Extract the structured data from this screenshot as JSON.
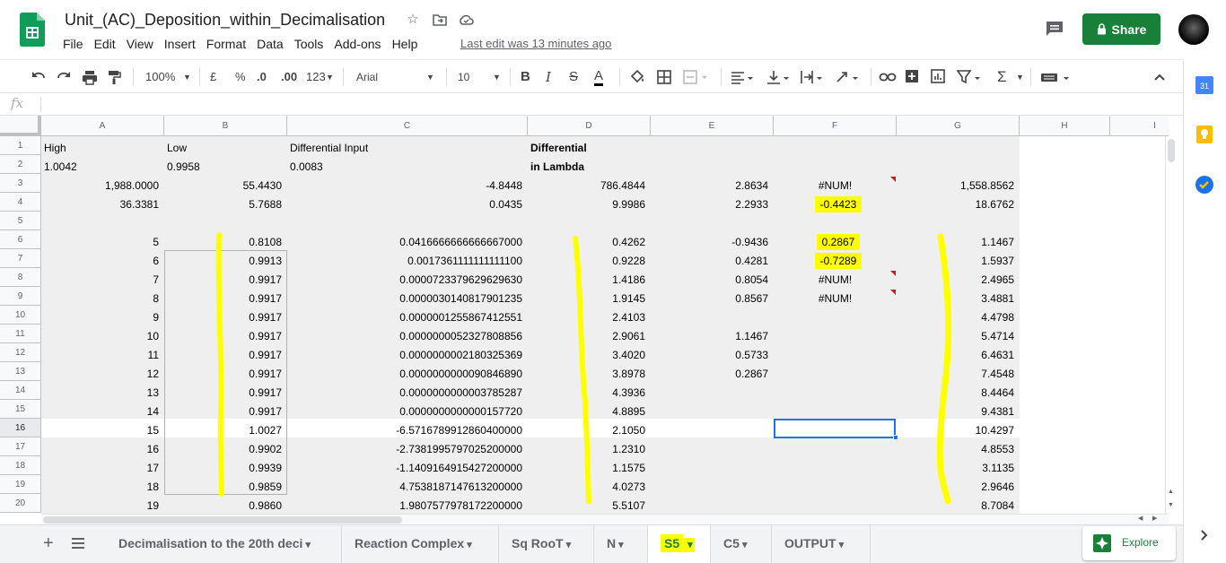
{
  "doc": {
    "title": "Unit_(AC)_Deposition_within_Decimalisation",
    "last_edit": "Last edit was 13 minutes ago"
  },
  "menu": [
    "File",
    "Edit",
    "View",
    "Insert",
    "Format",
    "Data",
    "Tools",
    "Add-ons",
    "Help"
  ],
  "share_label": "Share",
  "toolbar": {
    "zoom": "100%",
    "currency": "£",
    "percent": "%",
    "dec_less": ".0",
    "dec_more": ".00",
    "more_formats": "123",
    "font": "Arial",
    "font_size": "10",
    "bold": "B",
    "italic": "I",
    "strike": "S",
    "text_color": "A",
    "functions": "Σ"
  },
  "formula_bar": {
    "label": "fx",
    "value": ""
  },
  "columns": [
    "A",
    "B",
    "C",
    "D",
    "E",
    "F",
    "G",
    "H",
    "I"
  ],
  "rows": [
    "1",
    "2",
    "3",
    "4",
    "5",
    "6",
    "7",
    "8",
    "9",
    "10",
    "11",
    "12",
    "13",
    "14",
    "15",
    "16",
    "17",
    "18",
    "19",
    "20"
  ],
  "cells": {
    "r1": {
      "a": "High",
      "b": "Low",
      "c": "Differential Input",
      "d": "Differential"
    },
    "r2": {
      "a": "1.0042",
      "b": "0.9958",
      "c": "0.0083",
      "d": "in Lambda"
    },
    "r3": {
      "a": "1,988.0000",
      "b": "55.4430",
      "c": "-4.8448",
      "d": "786.4844",
      "e": "2.8634",
      "f": "#NUM!",
      "g": "1,558.8562"
    },
    "r4": {
      "a": "36.3381",
      "b": "5.7688",
      "c": "0.0435",
      "d": "9.9986",
      "e": "2.2933",
      "f": "-0.4423",
      "g": "18.6762"
    },
    "r6": {
      "a": "5",
      "b": "0.8108",
      "c": "0.0416666666666667000",
      "d": "0.4262",
      "e": "-0.9436",
      "f": "0.2867",
      "g": "1.1467"
    },
    "r7": {
      "a": "6",
      "b": "0.9913",
      "c": "0.0017361111111111100",
      "d": "0.9228",
      "e": "0.4281",
      "f": "-0.7289",
      "g": "1.5937"
    },
    "r8": {
      "a": "7",
      "b": "0.9917",
      "c": "0.0000723379629629630",
      "d": "1.4186",
      "e": "0.8054",
      "f": "#NUM!",
      "g": "2.4965"
    },
    "r9": {
      "a": "8",
      "b": "0.9917",
      "c": "0.0000030140817901235",
      "d": "1.9145",
      "e": "0.8567",
      "f": "#NUM!",
      "g": "3.4881"
    },
    "r10": {
      "a": "9",
      "b": "0.9917",
      "c": "0.0000001255867412551",
      "d": "2.4103",
      "g": "4.4798"
    },
    "r11": {
      "a": "10",
      "b": "0.9917",
      "c": "0.0000000052327808856",
      "d": "2.9061",
      "e": "1.1467",
      "g": "5.4714"
    },
    "r12": {
      "a": "11",
      "b": "0.9917",
      "c": "0.0000000002180325369",
      "d": "3.4020",
      "e": "0.5733",
      "g": "6.4631"
    },
    "r13": {
      "a": "12",
      "b": "0.9917",
      "c": "0.0000000000090846890",
      "d": "3.8978",
      "e": "0.2867",
      "g": "7.4548"
    },
    "r14": {
      "a": "13",
      "b": "0.9917",
      "c": "0.0000000000003785287",
      "d": "4.3936",
      "g": "8.4464"
    },
    "r15": {
      "a": "14",
      "b": "0.9917",
      "c": "0.0000000000000157720",
      "d": "4.8895",
      "g": "9.4381"
    },
    "r16": {
      "a": "15",
      "b": "1.0027",
      "c": "-6.5716789912860400000",
      "d": "2.1050",
      "g": "10.4297"
    },
    "r17": {
      "a": "16",
      "b": "0.9902",
      "c": "-2.7381995797025200000",
      "d": "1.2310",
      "g": "4.8553"
    },
    "r18": {
      "a": "17",
      "b": "0.9939",
      "c": "-1.1409164915427200000",
      "d": "1.1575",
      "g": "3.1135"
    },
    "r19": {
      "a": "18",
      "b": "0.9859",
      "c": "4.7538187147613200000",
      "d": "4.0273",
      "g": "2.9646"
    },
    "r20": {
      "a": "19",
      "b": "0.9860",
      "c": "1.9807577978172200000",
      "d": "5.5107",
      "g": "8.7084"
    }
  },
  "sheets": [
    "Decimalisation to the 20th deci",
    "Reaction Complex",
    "Sq RooT",
    "N",
    "S5",
    "C5",
    "OUTPUT"
  ],
  "active_sheet": "S5",
  "explore_label": "Explore",
  "colors": {
    "accent": "#188038",
    "selection": "#1a73e8",
    "highlight": "#ffff00",
    "grey_band": "#efefef"
  }
}
